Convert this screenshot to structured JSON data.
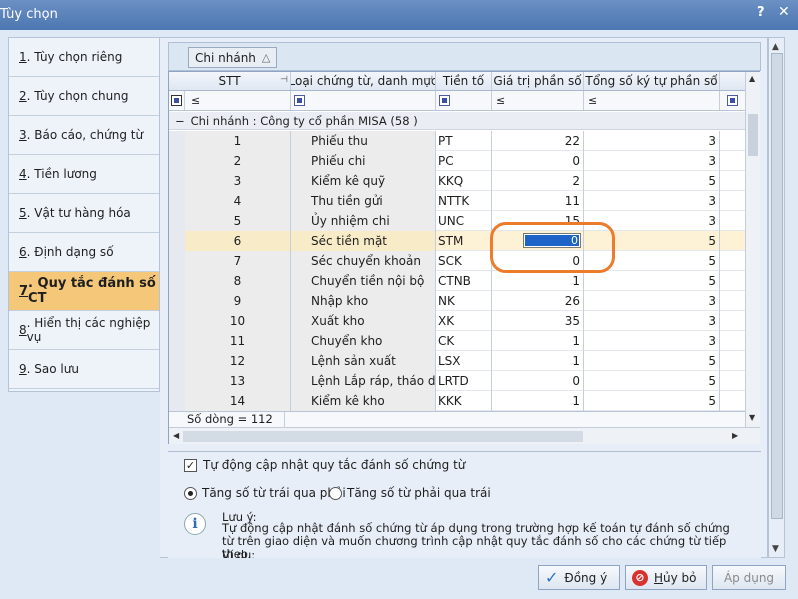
{
  "window": {
    "title": "Tùy chọn",
    "help": "?",
    "close": "✕"
  },
  "sidebar": {
    "items": [
      {
        "num": "1",
        "label": ". Tùy chọn riêng"
      },
      {
        "num": "2",
        "label": ". Tùy chọn chung"
      },
      {
        "num": "3",
        "label": ". Báo cáo, chứng từ"
      },
      {
        "num": "4",
        "label": ". Tiền lương"
      },
      {
        "num": "5",
        "label": ". Vật tư hàng hóa"
      },
      {
        "num": "6",
        "label": ". Định dạng số"
      },
      {
        "num": "7",
        "label": ". Quy tắc đánh số CT"
      },
      {
        "num": "8",
        "label": ". Hiển thị các nghiệp vụ"
      },
      {
        "num": "9",
        "label": ". Sao lưu"
      }
    ],
    "active_index": 6
  },
  "groupbar": {
    "chip": "Chi nhánh"
  },
  "grid": {
    "columns": [
      "STT",
      "Loại chứng từ, danh mục",
      "Tiền tố",
      "Giá trị phần số",
      "Tổng số ký tự phần số"
    ],
    "filter_ops": {
      "stt": "≤",
      "gt": "≤",
      "tong": "≤"
    },
    "group_row": "Chi nhánh : Công ty cổ phần MISA (58 )",
    "rows": [
      {
        "stt": "1",
        "loai": "Phiếu thu",
        "tien": "PT",
        "gt": "22",
        "tong": "3"
      },
      {
        "stt": "2",
        "loai": "Phiếu chi",
        "tien": "PC",
        "gt": "0",
        "tong": "3"
      },
      {
        "stt": "3",
        "loai": "Kiểm kê quỹ",
        "tien": "KKQ",
        "gt": "2",
        "tong": "5"
      },
      {
        "stt": "4",
        "loai": "Thu tiền gửi",
        "tien": "NTTK",
        "gt": "11",
        "tong": "3"
      },
      {
        "stt": "5",
        "loai": "Ủy nhiệm chi",
        "tien": "UNC",
        "gt": "15",
        "tong": "3"
      },
      {
        "stt": "6",
        "loai": "Séc tiền mặt",
        "tien": "STM",
        "gt": "0",
        "tong": "5"
      },
      {
        "stt": "7",
        "loai": "Séc chuyển khoản",
        "tien": "SCK",
        "gt": "0",
        "tong": "5"
      },
      {
        "stt": "8",
        "loai": "Chuyển tiền nội bộ",
        "tien": "CTNB",
        "gt": "1",
        "tong": "5"
      },
      {
        "stt": "9",
        "loai": "Nhập kho",
        "tien": "NK",
        "gt": "26",
        "tong": "3"
      },
      {
        "stt": "10",
        "loai": "Xuất kho",
        "tien": "XK",
        "gt": "35",
        "tong": "3"
      },
      {
        "stt": "11",
        "loai": "Chuyển kho",
        "tien": "CK",
        "gt": "1",
        "tong": "3"
      },
      {
        "stt": "12",
        "loai": "Lệnh sản xuất",
        "tien": "LSX",
        "gt": "1",
        "tong": "5"
      },
      {
        "stt": "13",
        "loai": "Lệnh Lắp ráp, tháo dỡ",
        "tien": "LRTD",
        "gt": "0",
        "tong": "5"
      },
      {
        "stt": "14",
        "loai": "Kiểm kê kho",
        "tien": "KKK",
        "gt": "1",
        "tong": "5"
      }
    ],
    "selected_row_index": 5,
    "footer": "Số dòng = 112"
  },
  "options": {
    "auto_update_label": "Tự động cập nhật quy tắc đánh số chứng từ",
    "auto_update_checked": true,
    "radio_ltr": "Tăng số từ trái qua phải",
    "radio_rtl": "Tăng số từ phải qua trái",
    "radio_selected": "ltr",
    "note_title": "Lưu ý:",
    "note_body": "Tự động cập nhật đánh số chứng từ áp dụng trong trường hợp kế toán tự đánh số chứng từ trên giao diện và muốn chương trình cập nhật quy tắc đánh số cho các chứng từ tiếp theo.",
    "note_example": "Ví dụ:"
  },
  "buttons": {
    "ok": "Đồng ý",
    "cancel_first": "H",
    "cancel_rest": "ủy bỏ",
    "apply": "Áp dụng"
  },
  "colors": {
    "active_tab": "#f4c878",
    "annotation": "#ec7b2c",
    "selection": "#1e64c8"
  }
}
